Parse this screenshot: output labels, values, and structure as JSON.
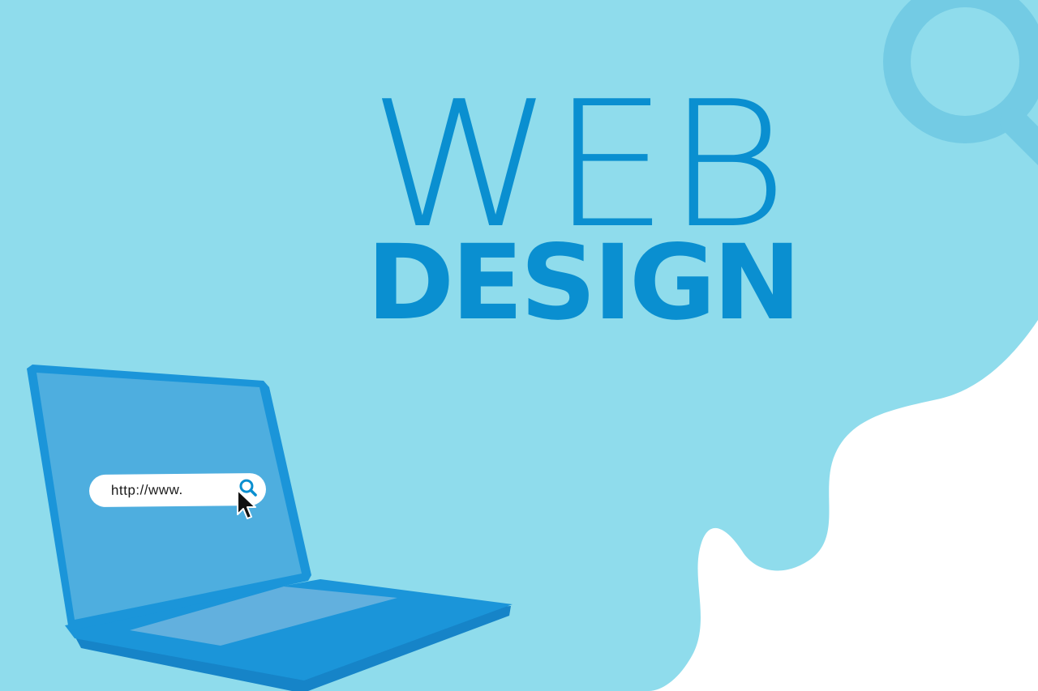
{
  "headline": {
    "line1": "WEB",
    "line2": "DESIGN"
  },
  "laptop": {
    "address_bar": {
      "value": "http://www."
    }
  },
  "icons": {
    "background_magnifier": "magnifier-icon",
    "search": "search-icon",
    "cursor": "cursor-arrow-icon"
  },
  "colors": {
    "accent_blue": "#0a8fd0",
    "background_blob": "#8fdcec",
    "laptop_body": "#1b95d9",
    "laptop_screen": "#4eaedf"
  }
}
